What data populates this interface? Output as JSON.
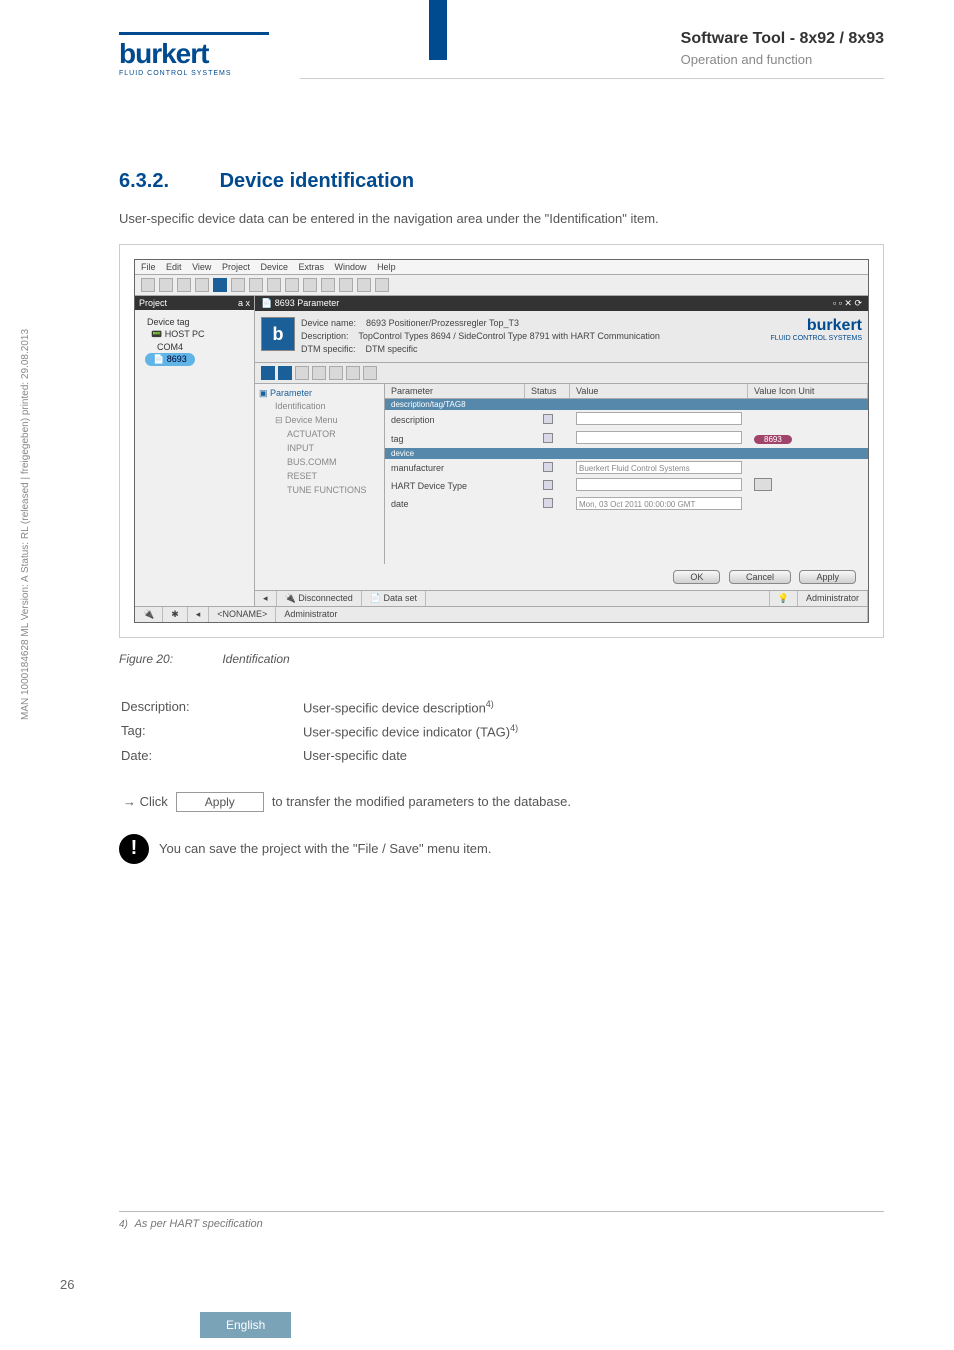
{
  "header": {
    "logo": "burkert",
    "logo_sub": "FLUID CONTROL SYSTEMS",
    "title": "Software Tool - 8x92 / 8x93",
    "subtitle": "Operation and function"
  },
  "section": {
    "number": "6.3.2.",
    "title": "Device identification",
    "intro": "User-specific device data can be entered in the navigation area under the \"Identification\" item."
  },
  "app": {
    "menus": [
      "File",
      "Edit",
      "View",
      "Project",
      "Device",
      "Extras",
      "Window",
      "Help"
    ],
    "project_panel_title": "Project",
    "project_float_hint": "a x",
    "tree": {
      "lvl0": "Device tag",
      "lvl1": "HOST PC",
      "lvl2": "COM4",
      "lvl3_selected": "8693"
    },
    "tab_title": "8693 Parameter",
    "device": {
      "name_label": "Device name:",
      "name_value": "8693 Positioner/Prozessregler Top_T3",
      "desc_label": "Description:",
      "desc_value": "TopControl Types 8694 / SideControl Type 8791 with HART Communication",
      "dtm_label": "DTM specific:",
      "dtm_value": "DTM specific"
    },
    "brand": {
      "name": "burkert",
      "sub": "FLUID CONTROL SYSTEMS"
    },
    "nav": {
      "root": "Parameter",
      "sel": "Identification",
      "children": [
        "Device Menu",
        "ACTUATOR",
        "INPUT",
        "BUS.COMM",
        "RESET",
        "TUNE FUNCTIONS"
      ]
    },
    "param_table": {
      "headers": {
        "c1": "Parameter",
        "c2": "Status",
        "c3": "Value",
        "c4": "Value Icon   Unit"
      },
      "group1": "description/tag/TAG8",
      "rows1": [
        {
          "name": "description",
          "value": ""
        },
        {
          "name": "tag",
          "value": "",
          "pill": "8693"
        }
      ],
      "group2": "device",
      "rows2": [
        {
          "name": "manufacturer",
          "value": "Buerkert Fluid Control Systems"
        },
        {
          "name": "HART Device Type",
          "value": "",
          "cal": true
        },
        {
          "name": "date",
          "value": "Mon, 03 Oct 2011 00:00:00 GMT"
        }
      ]
    },
    "buttons": {
      "ok": "OK",
      "cancel": "Cancel",
      "apply": "Apply"
    },
    "status": {
      "disconnected": "Disconnected",
      "dataset": "Data set",
      "admin": "Administrator",
      "noname": "<NONAME>"
    }
  },
  "figure": {
    "num": "Figure 20:",
    "caption": "Identification"
  },
  "desc": {
    "rows": [
      {
        "label": "Description:",
        "text": "User-specific device description",
        "sup": "4)"
      },
      {
        "label": "Tag:",
        "text": "User-specific device indicator (TAG)",
        "sup": "4)"
      },
      {
        "label": "Date:",
        "text": "User-specific date",
        "sup": ""
      }
    ]
  },
  "click": {
    "prefix": "→ Click",
    "button": "Apply",
    "suffix": " to transfer the modified parameters to the database."
  },
  "note": "You can save the project with the \"File / Save\" menu item.",
  "side": "MAN 1000184628 ML Version: A Status: RL (released | freigegeben) printed: 29.08.2013",
  "footnote": {
    "num": "4)",
    "text": "As per HART specification"
  },
  "pagenum": "26",
  "lang": "English"
}
